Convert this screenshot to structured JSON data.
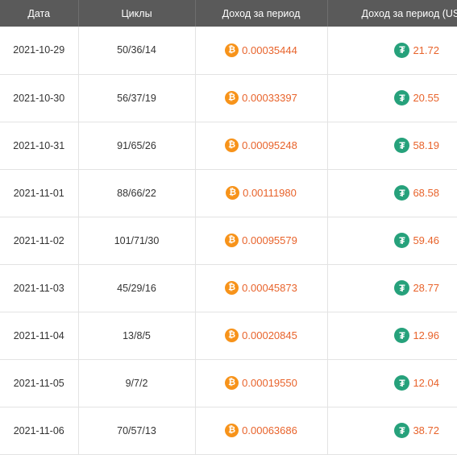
{
  "headers": [
    "Дата",
    "Циклы",
    "Доход за период",
    "Доход за период (USDT)"
  ],
  "icons": {
    "btc": "bitcoin-icon",
    "usdt": "tether-icon"
  },
  "colors": {
    "header_bg": "#5a5a5a",
    "value": "#e8632b",
    "btc": "#f7931a",
    "usdt": "#26a17b"
  },
  "rows": [
    {
      "date": "2021-10-29",
      "cycles": "50/36/14",
      "btc": "0.00035444",
      "usdt": "21.72"
    },
    {
      "date": "2021-10-30",
      "cycles": "56/37/19",
      "btc": "0.00033397",
      "usdt": "20.55"
    },
    {
      "date": "2021-10-31",
      "cycles": "91/65/26",
      "btc": "0.00095248",
      "usdt": "58.19"
    },
    {
      "date": "2021-11-01",
      "cycles": "88/66/22",
      "btc": "0.00111980",
      "usdt": "68.58"
    },
    {
      "date": "2021-11-02",
      "cycles": "101/71/30",
      "btc": "0.00095579",
      "usdt": "59.46"
    },
    {
      "date": "2021-11-03",
      "cycles": "45/29/16",
      "btc": "0.00045873",
      "usdt": "28.77"
    },
    {
      "date": "2021-11-04",
      "cycles": "13/8/5",
      "btc": "0.00020845",
      "usdt": "12.96"
    },
    {
      "date": "2021-11-05",
      "cycles": "9/7/2",
      "btc": "0.00019550",
      "usdt": "12.04"
    },
    {
      "date": "2021-11-06",
      "cycles": "70/57/13",
      "btc": "0.00063686",
      "usdt": "38.72"
    }
  ]
}
